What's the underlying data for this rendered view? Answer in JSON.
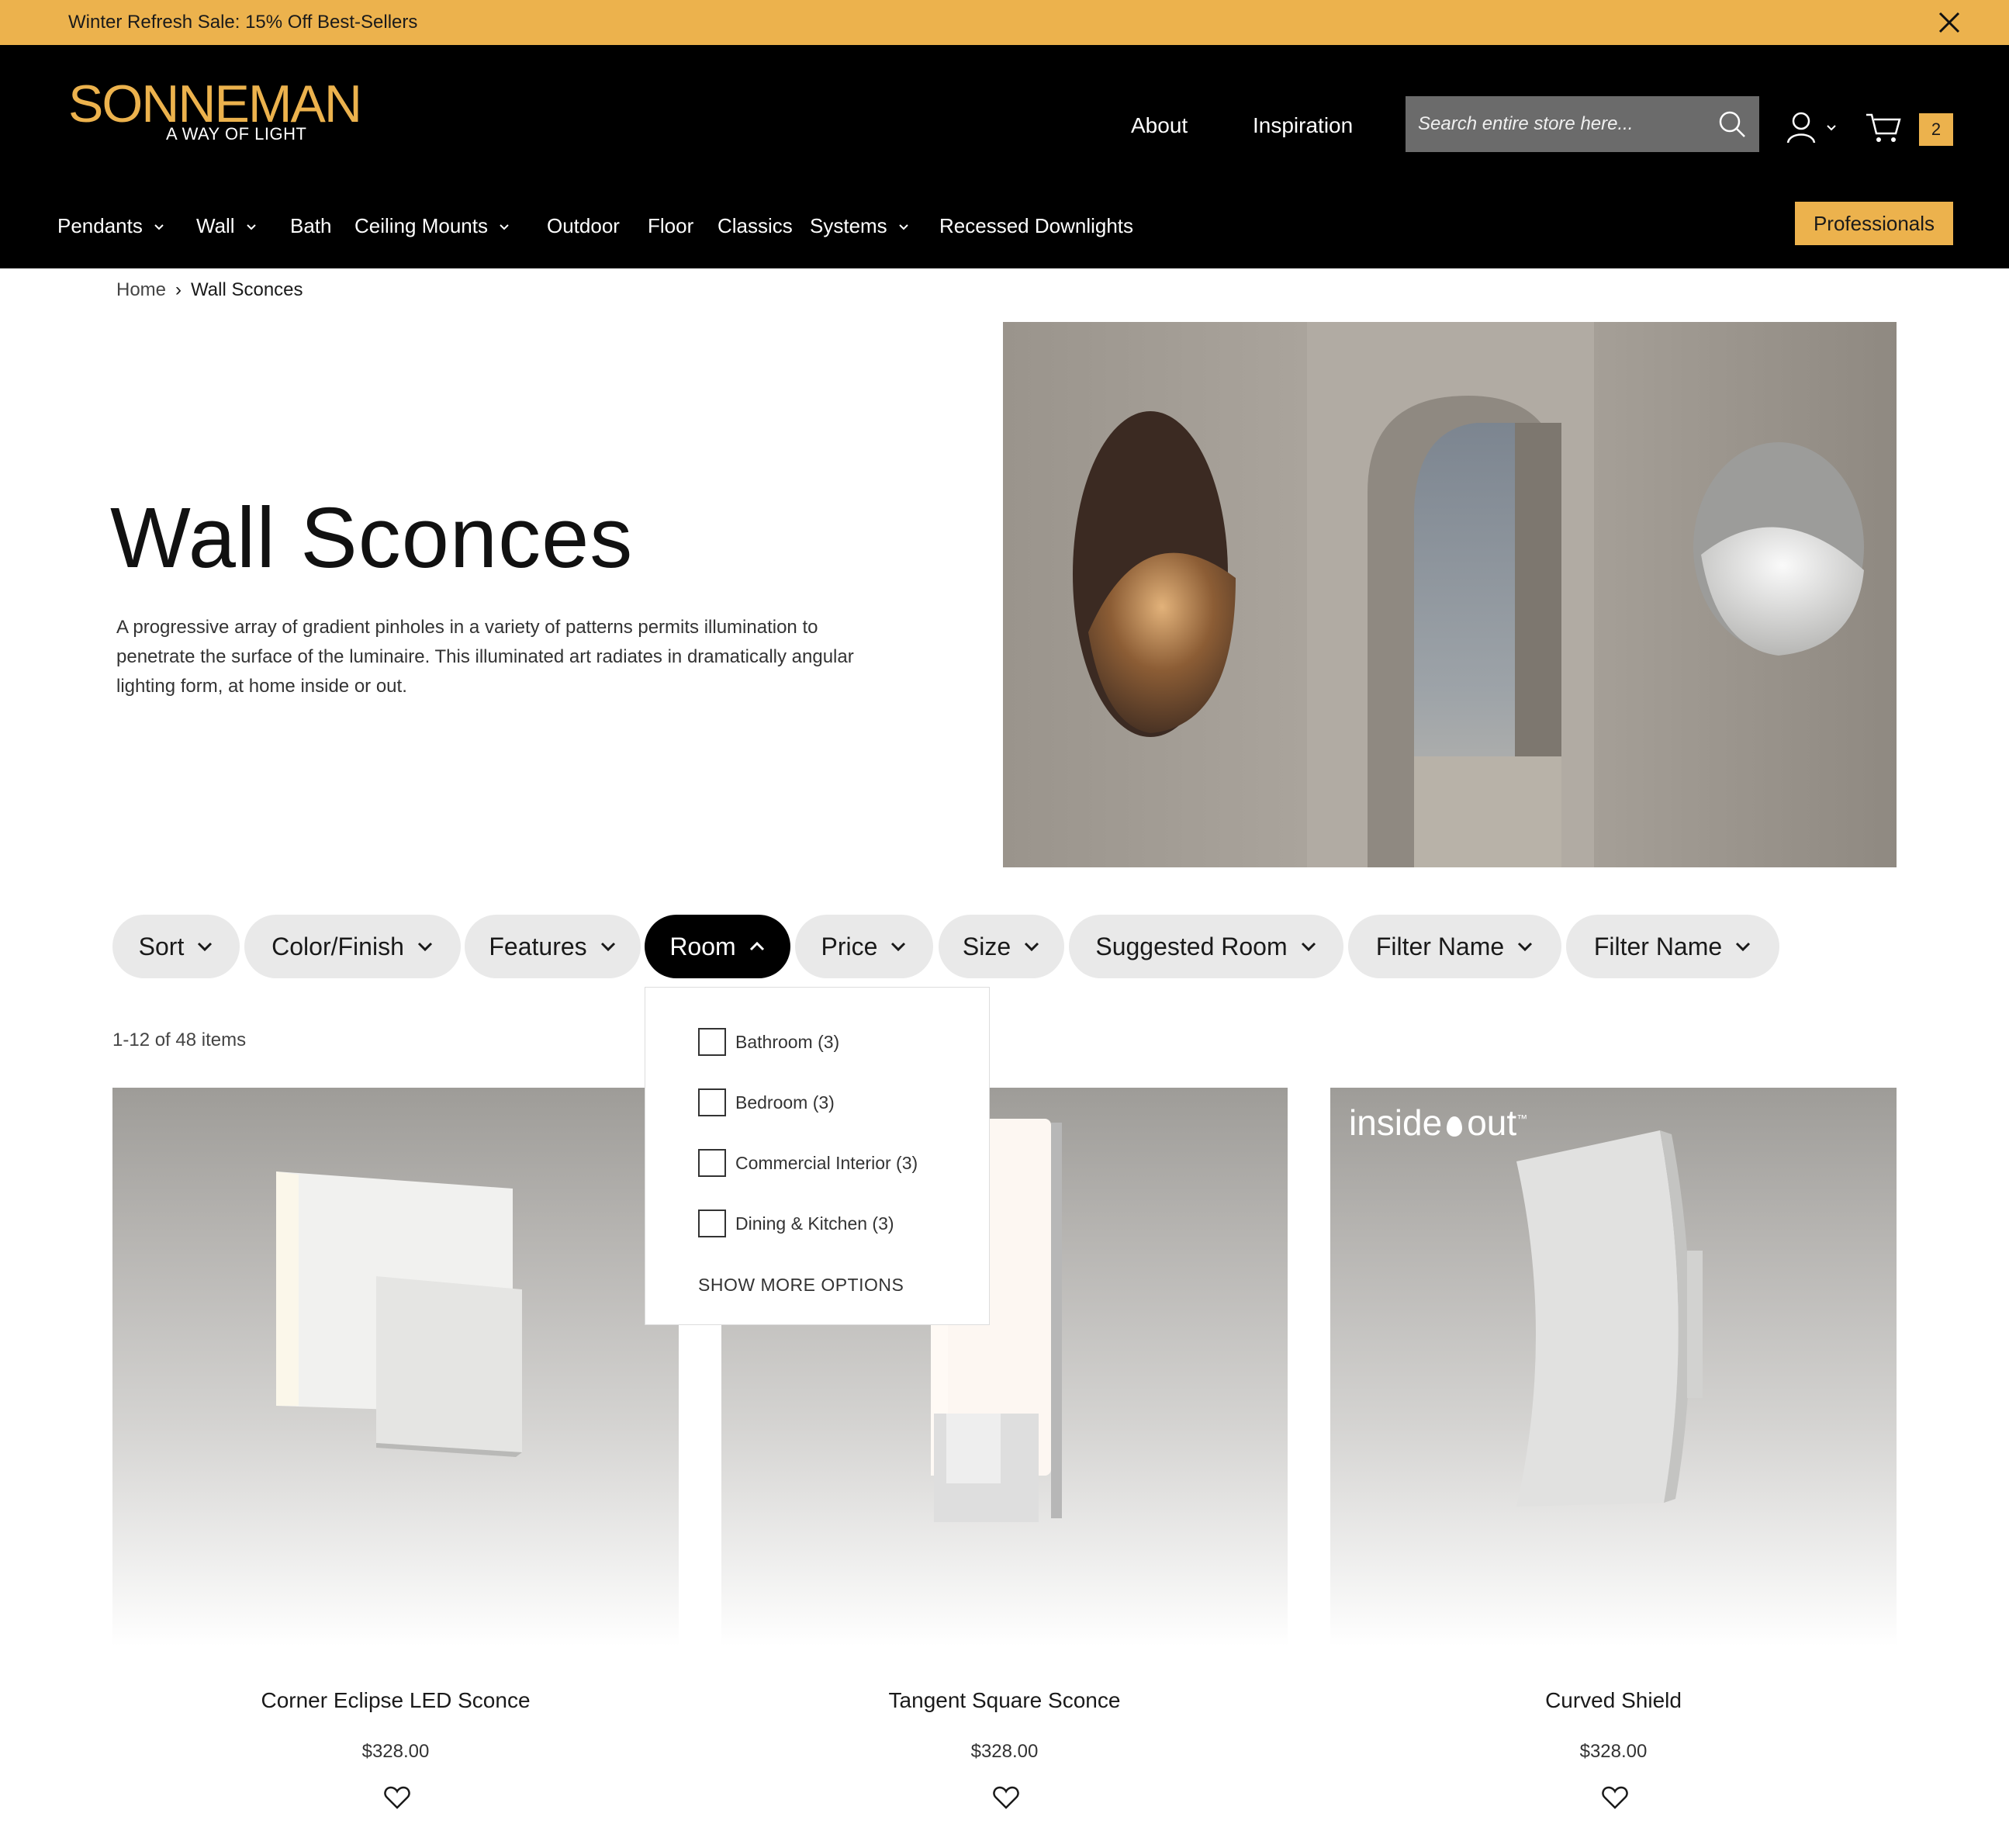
{
  "promo": {
    "text": "Winter Refresh Sale: 15% Off Best-Sellers"
  },
  "brand": {
    "name": "SONNEMAN",
    "tagline": "A WAY OF LIGHT",
    "accent": "#ecb24d"
  },
  "header": {
    "links": [
      "About",
      "Inspiration"
    ],
    "search_placeholder": "Search entire store here...",
    "cart_count": "2"
  },
  "nav": {
    "items": [
      {
        "label": "Pendants",
        "dropdown": true
      },
      {
        "label": "Wall",
        "dropdown": true
      },
      {
        "label": "Bath",
        "dropdown": false
      },
      {
        "label": "Ceiling Mounts",
        "dropdown": true
      },
      {
        "label": "Outdoor",
        "dropdown": false
      },
      {
        "label": "Floor",
        "dropdown": false
      },
      {
        "label": "Classics",
        "dropdown": false
      },
      {
        "label": "Systems",
        "dropdown": true
      },
      {
        "label": "Recessed Downlights",
        "dropdown": false
      }
    ],
    "professionals": "Professionals"
  },
  "breadcrumb": {
    "home": "Home",
    "separator": "›",
    "current": "Wall Sconces"
  },
  "page": {
    "title": "Wall Sconces",
    "description": "A progressive array of gradient pinholes in a variety of patterns permits illumination to penetrate the surface of the luminaire. This illuminated art radiates in dramatically angular lighting form, at home inside or out."
  },
  "filters": {
    "pills": [
      {
        "label": "Sort",
        "active": false
      },
      {
        "label": "Color/Finish",
        "active": false
      },
      {
        "label": "Features",
        "active": false
      },
      {
        "label": "Room",
        "active": true
      },
      {
        "label": "Price",
        "active": false
      },
      {
        "label": "Size",
        "active": false
      },
      {
        "label": "Suggested Room",
        "active": false
      },
      {
        "label": "Filter Name",
        "active": false
      },
      {
        "label": "Filter Name",
        "active": false
      }
    ],
    "room_options": [
      "Bathroom (3)",
      "Bedroom (3)",
      "Commercial Interior (3)",
      "Dining & Kitchen (3)"
    ],
    "show_more": "SHOW MORE OPTIONS"
  },
  "results": {
    "count_text": "1-12 of 48 items"
  },
  "products": [
    {
      "name": "Corner Eclipse LED Sconce",
      "price": "$328.00"
    },
    {
      "name": "Tangent Square Sconce",
      "price": "$328.00"
    },
    {
      "name": "Curved Shield",
      "price": "$328.00",
      "badge": "inside",
      "badge2": "out",
      "badge_tm": "™"
    }
  ]
}
